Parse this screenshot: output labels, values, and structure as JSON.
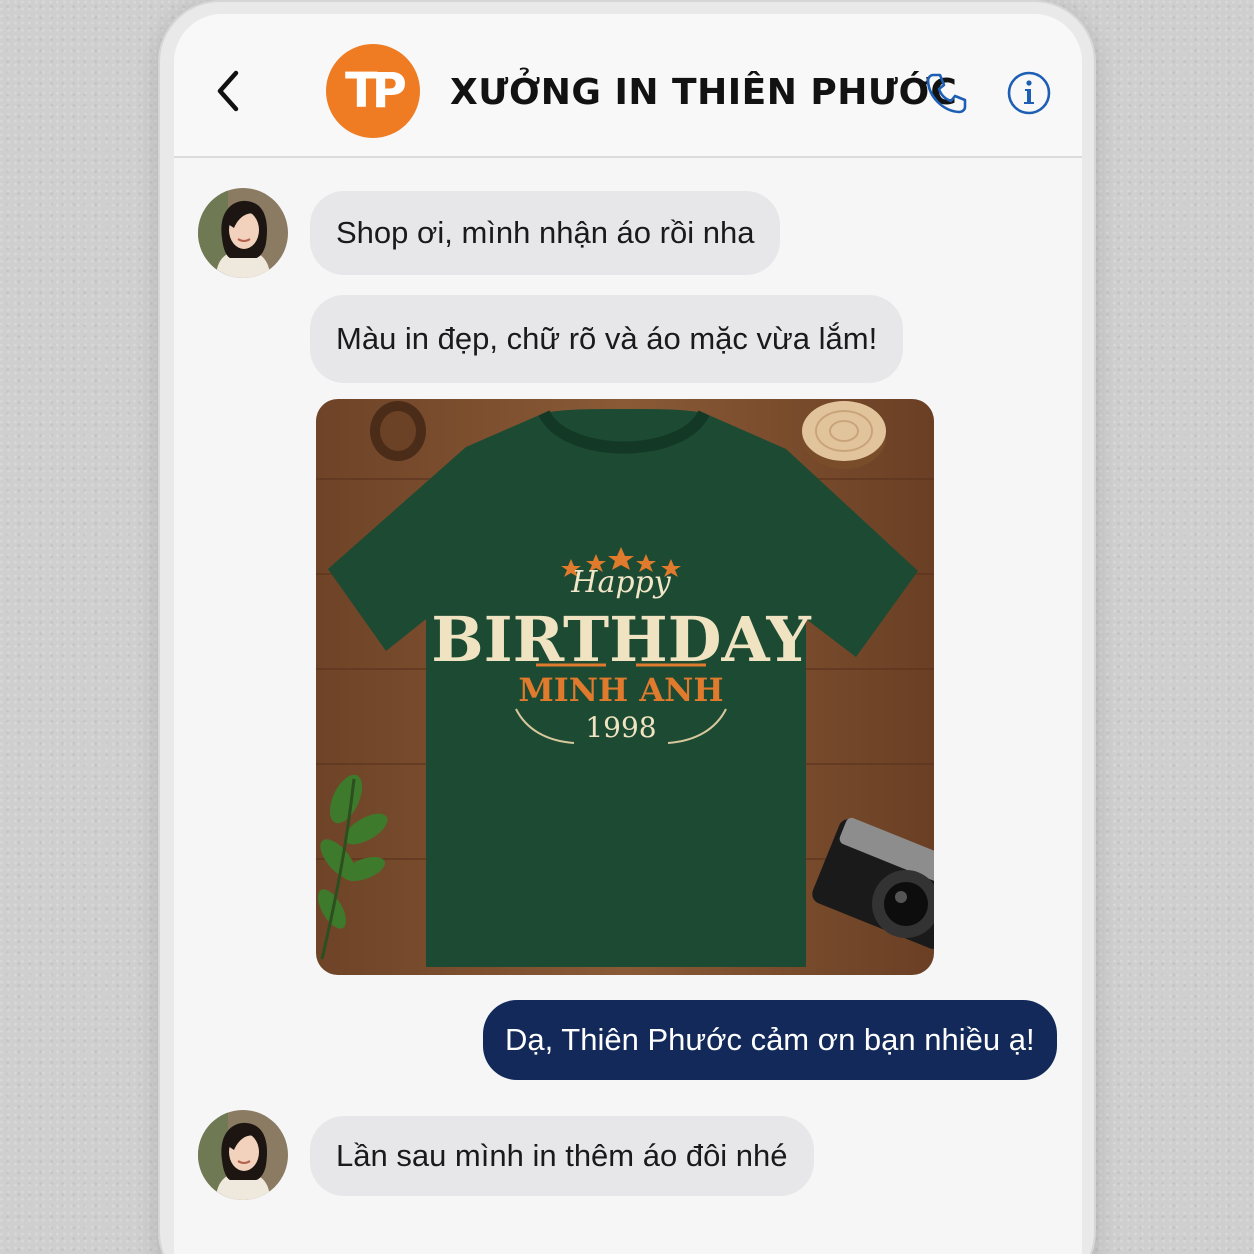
{
  "header": {
    "back_icon": "chevron-left-icon",
    "logo_text": "TP",
    "shop_name": "XƯỞNG IN THIÊN PHƯỚC",
    "call_icon": "phone-icon",
    "info_icon": "info-icon"
  },
  "messages": [
    {
      "sender": "customer",
      "text": "Shop ơi, mình nhận áo rồi nha"
    },
    {
      "sender": "customer",
      "text": "Màu in đẹp, chữ rõ và áo mặc vừa lắm!"
    },
    {
      "sender": "shop",
      "text": "Dạ, Thiên Phước cảm ơn bạn nhiều ạ!"
    },
    {
      "sender": "customer",
      "text": "Lần sau mình in thêm áo đôi nhé"
    }
  ],
  "photo": {
    "shirt_print": {
      "script_text": "Happy",
      "headline": "BIRTHDAY",
      "name": "MINH ANH",
      "year": "1998"
    }
  },
  "colors": {
    "brand_orange": "#ef7c22",
    "outgoing_bubble": "#13295a",
    "incoming_bubble": "#e7e7e9",
    "icon_blue": "#1d5fb4",
    "shirt_green": "#1c4a32"
  }
}
